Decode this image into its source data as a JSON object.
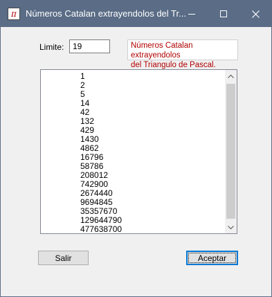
{
  "window": {
    "title": "Números Catalan extrayendolos del Tr...",
    "app_icon_glyph": "π",
    "controls": {
      "minimize": "minimize-icon",
      "maximize": "maximize-icon",
      "close": "close-icon"
    }
  },
  "form": {
    "limit_label": "Limite:",
    "limit_value": "19",
    "info_line1": "Números Catalan extrayendolos",
    "info_line2": "del Triangulo de Pascal."
  },
  "results": {
    "items": [
      "1",
      "2",
      "5",
      "14",
      "42",
      "132",
      "429",
      "1430",
      "4862",
      "16796",
      "58786",
      "208012",
      "742900",
      "2674440",
      "9694845",
      "35357670",
      "129644790",
      "477638700"
    ]
  },
  "buttons": {
    "exit_label": "Salir",
    "accept_label": "Aceptar"
  },
  "colors": {
    "titlebar": "#5a6c86",
    "info_text": "#b00000",
    "focus": "#0078d7"
  }
}
